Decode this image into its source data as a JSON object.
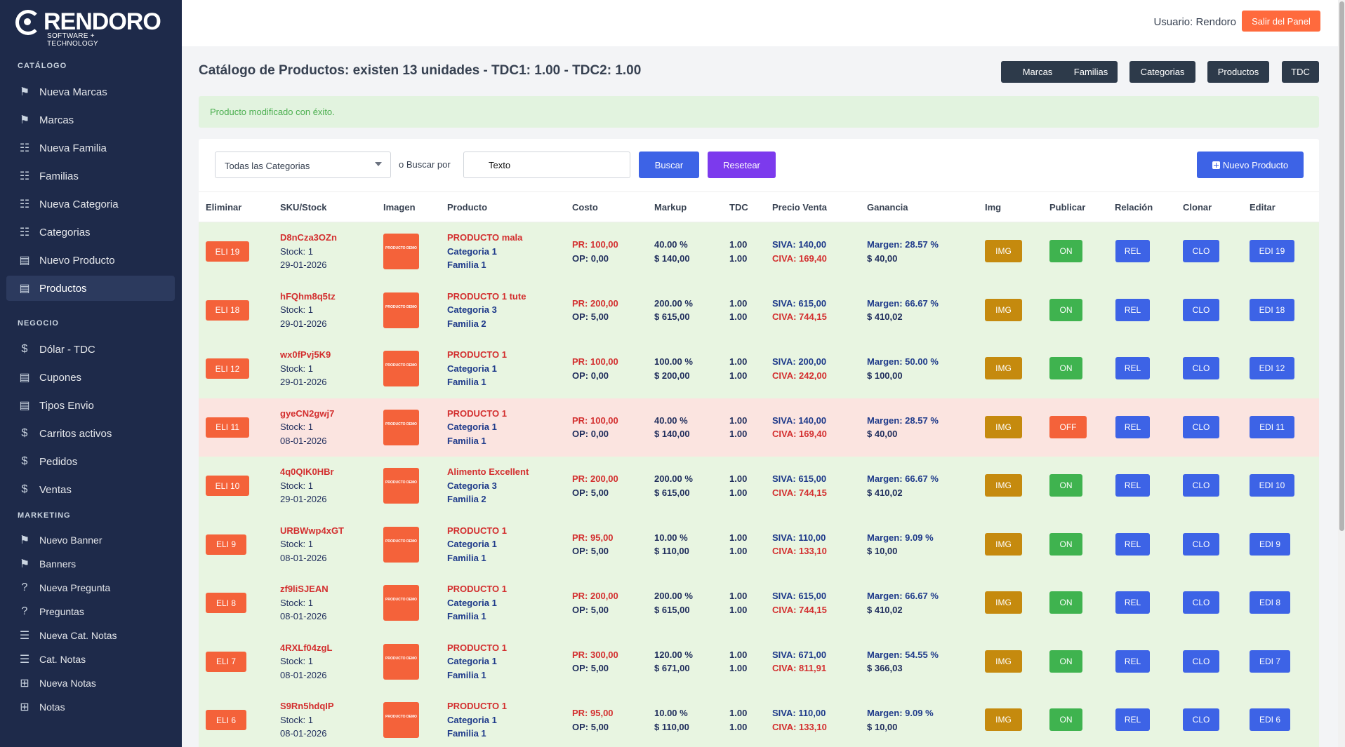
{
  "brand": {
    "name": "RENDORO",
    "tagline": "SOFTWARE + TECHNOLOGY"
  },
  "sidebar": {
    "sections": [
      "CATÁLOGO",
      "NEGOCIO",
      "MARKETING"
    ],
    "items": [
      {
        "label": "Nueva Marcas",
        "icon": "tags-icon"
      },
      {
        "label": "Marcas",
        "icon": "tags-icon"
      },
      {
        "label": "Nueva Familia",
        "icon": "table-icon"
      },
      {
        "label": "Familias",
        "icon": "table-icon"
      },
      {
        "label": "Nueva Categoria",
        "icon": "sitemap-icon"
      },
      {
        "label": "Categorias",
        "icon": "sitemap-icon"
      },
      {
        "label": "Nuevo Producto",
        "icon": "archive-icon"
      },
      {
        "label": "Productos",
        "icon": "archive-icon"
      },
      {
        "label": "Dólar - TDC",
        "icon": "dollar-icon"
      },
      {
        "label": "Cupones",
        "icon": "archive-icon"
      },
      {
        "label": "Tipos Envio",
        "icon": "archive-icon"
      },
      {
        "label": "Carritos activos",
        "icon": "dollar-icon"
      },
      {
        "label": "Pedidos",
        "icon": "dollar-icon"
      },
      {
        "label": "Ventas",
        "icon": "dollar-icon"
      },
      {
        "label": "Nuevo Banner",
        "icon": "flag-icon"
      },
      {
        "label": "Banners",
        "icon": "flag-icon"
      },
      {
        "label": "Nueva Pregunta",
        "icon": "question-icon"
      },
      {
        "label": "Preguntas",
        "icon": "question-icon"
      },
      {
        "label": "Nueva Cat. Notas",
        "icon": "list-icon"
      },
      {
        "label": "Cat. Notas",
        "icon": "list-icon"
      },
      {
        "label": "Nueva Notas",
        "icon": "grid-icon"
      },
      {
        "label": "Notas",
        "icon": "grid-icon"
      }
    ]
  },
  "header": {
    "user": "Usuario: Rendoro",
    "logout": "Salir del Panel"
  },
  "page": {
    "title": "Catálogo de Productos: existen 13 unidades - TDC1: 1.00 - TDC2: 1.00",
    "nav": [
      "Marcas",
      "Familias",
      "Categorias",
      "Productos",
      "TDC"
    ],
    "alert": "Producto modificado con éxito."
  },
  "filters": {
    "category": "Todas las Categorias",
    "or_label": "o Buscar por",
    "search_value": "Texto",
    "search_btn": "Buscar",
    "reset_btn": "Resetear",
    "new_btn": "Nuevo Producto"
  },
  "table": {
    "headers": [
      "Eliminar",
      "SKU/Stock",
      "Imagen",
      "Producto",
      "Costo",
      "Markup",
      "TDC",
      "Precio Venta",
      "Ganancia",
      "Img",
      "Publicar",
      "Relación",
      "Clonar",
      "Editar"
    ],
    "image_placeholder": "PRODUCTO DEMO",
    "rows": [
      {
        "eli": "ELI 19",
        "sku": "D8nCza3OZn",
        "stock": "Stock: 1",
        "date": "29-01-2026",
        "name": "PRODUCTO mala",
        "cat": "Categoria 1",
        "fam": "Familia 1",
        "pr": "PR: 100,00",
        "op": "OP: 0,00",
        "markup": "40.00 %",
        "mprice": "$ 140,00",
        "tdc1": "1.00",
        "tdc2": "1.00",
        "siva": "SIVA: 140,00",
        "civa": "CIVA: 169,40",
        "margin": "Margen: 28.57 %",
        "gain": "$ 40,00",
        "img": "IMG",
        "pub": "ON",
        "rel": "REL",
        "clo": "CLO",
        "edi": "EDI 19"
      },
      {
        "eli": "ELI 18",
        "sku": "hFQhm8q5tz",
        "stock": "Stock: 1",
        "date": "29-01-2026",
        "name": "PRODUCTO 1 tute",
        "cat": "Categoria 3",
        "fam": "Familia 2",
        "pr": "PR: 200,00",
        "op": "OP: 5,00",
        "markup": "200.00 %",
        "mprice": "$ 615,00",
        "tdc1": "1.00",
        "tdc2": "1.00",
        "siva": "SIVA: 615,00",
        "civa": "CIVA: 744,15",
        "margin": "Margen: 66.67 %",
        "gain": "$ 410,02",
        "img": "IMG",
        "pub": "ON",
        "rel": "REL",
        "clo": "CLO",
        "edi": "EDI 18"
      },
      {
        "eli": "ELI 12",
        "sku": "wx0fPvj5K9",
        "stock": "Stock: 1",
        "date": "29-01-2026",
        "name": "PRODUCTO 1",
        "cat": "Categoria 1",
        "fam": "Familia 1",
        "pr": "PR: 100,00",
        "op": "OP: 0,00",
        "markup": "100.00 %",
        "mprice": "$ 200,00",
        "tdc1": "1.00",
        "tdc2": "1.00",
        "siva": "SIVA: 200,00",
        "civa": "CIVA: 242,00",
        "margin": "Margen: 50.00 %",
        "gain": "$ 100,00",
        "img": "IMG",
        "pub": "ON",
        "rel": "REL",
        "clo": "CLO",
        "edi": "EDI 12"
      },
      {
        "eli": "ELI 11",
        "sku": "gyeCN2gwj7",
        "stock": "Stock: 1",
        "date": "08-01-2026",
        "name": "PRODUCTO 1",
        "cat": "Categoria 1",
        "fam": "Familia 1",
        "pr": "PR: 100,00",
        "op": "OP: 0,00",
        "markup": "40.00 %",
        "mprice": "$ 140,00",
        "tdc1": "1.00",
        "tdc2": "1.00",
        "siva": "SIVA: 140,00",
        "civa": "CIVA: 169,40",
        "margin": "Margen: 28.57 %",
        "gain": "$ 40,00",
        "img": "IMG",
        "pub": "OFF",
        "rel": "REL",
        "clo": "CLO",
        "edi": "EDI 11"
      },
      {
        "eli": "ELI 10",
        "sku": "4q0QIK0HBr",
        "stock": "Stock: 1",
        "date": "29-01-2026",
        "name": "Alimento Excellent",
        "cat": "Categoria 3",
        "fam": "Familia 2",
        "pr": "PR: 200,00",
        "op": "OP: 5,00",
        "markup": "200.00 %",
        "mprice": "$ 615,00",
        "tdc1": "1.00",
        "tdc2": "1.00",
        "siva": "SIVA: 615,00",
        "civa": "CIVA: 744,15",
        "margin": "Margen: 66.67 %",
        "gain": "$ 410,02",
        "img": "IMG",
        "pub": "ON",
        "rel": "REL",
        "clo": "CLO",
        "edi": "EDI 10"
      },
      {
        "eli": "ELI 9",
        "sku": "URBWwp4xGT",
        "stock": "Stock: 1",
        "date": "08-01-2026",
        "name": "PRODUCTO 1",
        "cat": "Categoria 1",
        "fam": "Familia 1",
        "pr": "PR: 95,00",
        "op": "OP: 5,00",
        "markup": "10.00 %",
        "mprice": "$ 110,00",
        "tdc1": "1.00",
        "tdc2": "1.00",
        "siva": "SIVA: 110,00",
        "civa": "CIVA: 133,10",
        "margin": "Margen: 9.09 %",
        "gain": "$ 10,00",
        "img": "IMG",
        "pub": "ON",
        "rel": "REL",
        "clo": "CLO",
        "edi": "EDI 9"
      },
      {
        "eli": "ELI 8",
        "sku": "zf9liSJEAN",
        "stock": "Stock: 1",
        "date": "08-01-2026",
        "name": "PRODUCTO 1",
        "cat": "Categoria 1",
        "fam": "Familia 1",
        "pr": "PR: 200,00",
        "op": "OP: 5,00",
        "markup": "200.00 %",
        "mprice": "$ 615,00",
        "tdc1": "1.00",
        "tdc2": "1.00",
        "siva": "SIVA: 615,00",
        "civa": "CIVA: 744,15",
        "margin": "Margen: 66.67 %",
        "gain": "$ 410,02",
        "img": "IMG",
        "pub": "ON",
        "rel": "REL",
        "clo": "CLO",
        "edi": "EDI 8"
      },
      {
        "eli": "ELI 7",
        "sku": "4RXLf04zgL",
        "stock": "Stock: 1",
        "date": "08-01-2026",
        "name": "PRODUCTO 1",
        "cat": "Categoria 1",
        "fam": "Familia 1",
        "pr": "PR: 300,00",
        "op": "OP: 5,00",
        "markup": "120.00 %",
        "mprice": "$ 671,00",
        "tdc1": "1.00",
        "tdc2": "1.00",
        "siva": "SIVA: 671,00",
        "civa": "CIVA: 811,91",
        "margin": "Margen: 54.55 %",
        "gain": "$ 366,03",
        "img": "IMG",
        "pub": "ON",
        "rel": "REL",
        "clo": "CLO",
        "edi": "EDI 7"
      },
      {
        "eli": "ELI 6",
        "sku": "S9Rn5hdqIP",
        "stock": "Stock: 1",
        "date": "08-01-2026",
        "name": "PRODUCTO 1",
        "cat": "Categoria 1",
        "fam": "Familia 1",
        "pr": "PR: 95,00",
        "op": "OP: 5,00",
        "markup": "10.00 %",
        "mprice": "$ 110,00",
        "tdc1": "1.00",
        "tdc2": "1.00",
        "siva": "SIVA: 110,00",
        "civa": "CIVA: 133,10",
        "margin": "Margen: 9.09 %",
        "gain": "$ 10,00",
        "img": "IMG",
        "pub": "ON",
        "rel": "REL",
        "clo": "CLO",
        "edi": "EDI 6"
      }
    ]
  }
}
